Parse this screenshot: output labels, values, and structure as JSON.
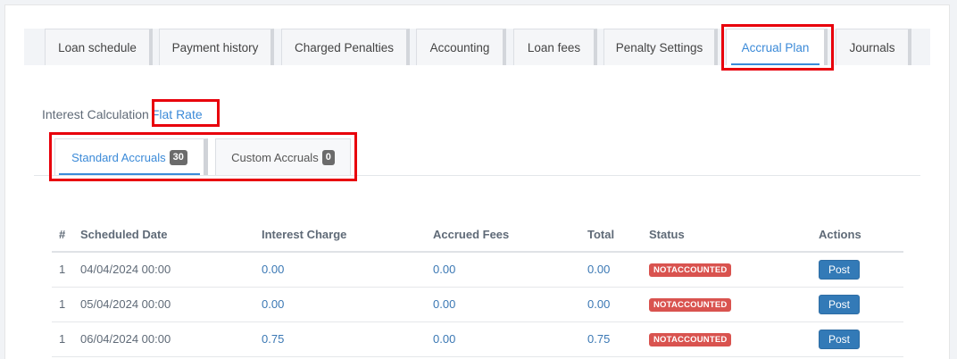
{
  "tabs": [
    {
      "label": "Loan schedule"
    },
    {
      "label": "Payment history"
    },
    {
      "label": "Charged Penalties"
    },
    {
      "label": "Accounting"
    },
    {
      "label": "Loan fees"
    },
    {
      "label": "Penalty Settings"
    },
    {
      "label": "Accrual Plan"
    },
    {
      "label": "Journals"
    }
  ],
  "interest": {
    "label": "Interest Calculation",
    "value": "Flat Rate"
  },
  "subtabs": {
    "standard": {
      "label": "Standard Accruals",
      "count": "30"
    },
    "custom": {
      "label": "Custom Accruals",
      "count": "0"
    }
  },
  "table": {
    "headers": [
      "#",
      "Scheduled Date",
      "Interest Charge",
      "Accrued Fees",
      "Total",
      "Status",
      "Actions"
    ],
    "rows": [
      {
        "num": "1",
        "date": "04/04/2024 00:00",
        "interest": "0.00",
        "fees": "0.00",
        "total": "0.00",
        "status": "NOTACCOUNTED",
        "action": "Post"
      },
      {
        "num": "1",
        "date": "05/04/2024 00:00",
        "interest": "0.00",
        "fees": "0.00",
        "total": "0.00",
        "status": "NOTACCOUNTED",
        "action": "Post"
      },
      {
        "num": "1",
        "date": "06/04/2024 00:00",
        "interest": "0.75",
        "fees": "0.00",
        "total": "0.75",
        "status": "NOTACCOUNTED",
        "action": "Post"
      }
    ]
  },
  "colors": {
    "accent": "#3b8ad8",
    "danger": "#d9534f",
    "primary_button": "#337ab7",
    "highlight": "#e8000b"
  }
}
